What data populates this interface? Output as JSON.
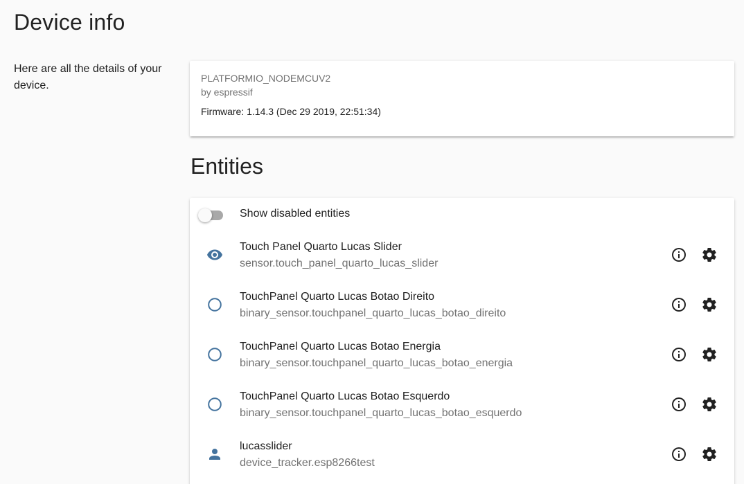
{
  "page": {
    "title": "Device info",
    "description": "Here are all the details of your device."
  },
  "device": {
    "model": "PLATFORMIO_NODEMCUV2",
    "manufacturer": "by espressif",
    "firmware": "Firmware: 1.14.3 (Dec 29 2019, 22:51:34)"
  },
  "entities": {
    "title": "Entities",
    "show_disabled_label": "Show disabled entities",
    "show_disabled": false,
    "items": [
      {
        "name": "Touch Panel Quarto Lucas Slider",
        "entity_id": "sensor.touch_panel_quarto_lucas_slider",
        "icon": "eye-icon"
      },
      {
        "name": "TouchPanel Quarto Lucas Botao Direito",
        "entity_id": "binary_sensor.touchpanel_quarto_lucas_botao_direito",
        "icon": "circle-outline-icon"
      },
      {
        "name": "TouchPanel Quarto Lucas Botao Energia",
        "entity_id": "binary_sensor.touchpanel_quarto_lucas_botao_energia",
        "icon": "circle-outline-icon"
      },
      {
        "name": "TouchPanel Quarto Lucas Botao Esquerdo",
        "entity_id": "binary_sensor.touchpanel_quarto_lucas_botao_esquerdo",
        "icon": "circle-outline-icon"
      },
      {
        "name": "lucasslider",
        "entity_id": "device_tracker.esp8266test",
        "icon": "account-icon"
      }
    ]
  },
  "colors": {
    "icon_state": "#44739e",
    "text_primary": "#212121",
    "text_secondary": "#727272"
  }
}
